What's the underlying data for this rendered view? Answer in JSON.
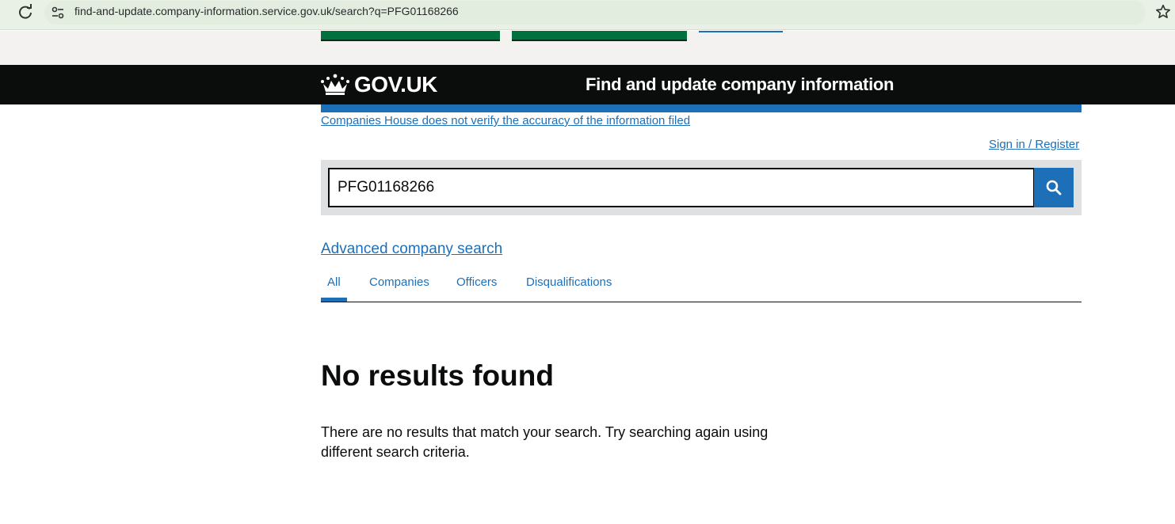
{
  "browser": {
    "url": "find-and-update.company-information.service.gov.uk/search?q=PFG01168266"
  },
  "header": {
    "logo_text": "GOV.UK",
    "service_name": "Find and update company information"
  },
  "notices": {
    "disclaimer": "Companies House does not verify the accuracy of the information filed",
    "signin": "Sign in / Register"
  },
  "search": {
    "value": "PFG01168266",
    "advanced_link": "Advanced company search"
  },
  "tabs": [
    {
      "label": "All",
      "selected": true
    },
    {
      "label": "Companies",
      "selected": false
    },
    {
      "label": "Officers",
      "selected": false
    },
    {
      "label": "Disqualifications",
      "selected": false
    }
  ],
  "results": {
    "heading": "No results found",
    "message": "There are no results that match your search. Try searching again using different search criteria."
  },
  "colors": {
    "link": "#1d70b8",
    "header_bg": "#0b0c0c",
    "button_green": "#00703c"
  },
  "icons": [
    "back-icon",
    "reload-icon",
    "site-info-icon",
    "star-icon",
    "crown-icon",
    "search-icon"
  ]
}
